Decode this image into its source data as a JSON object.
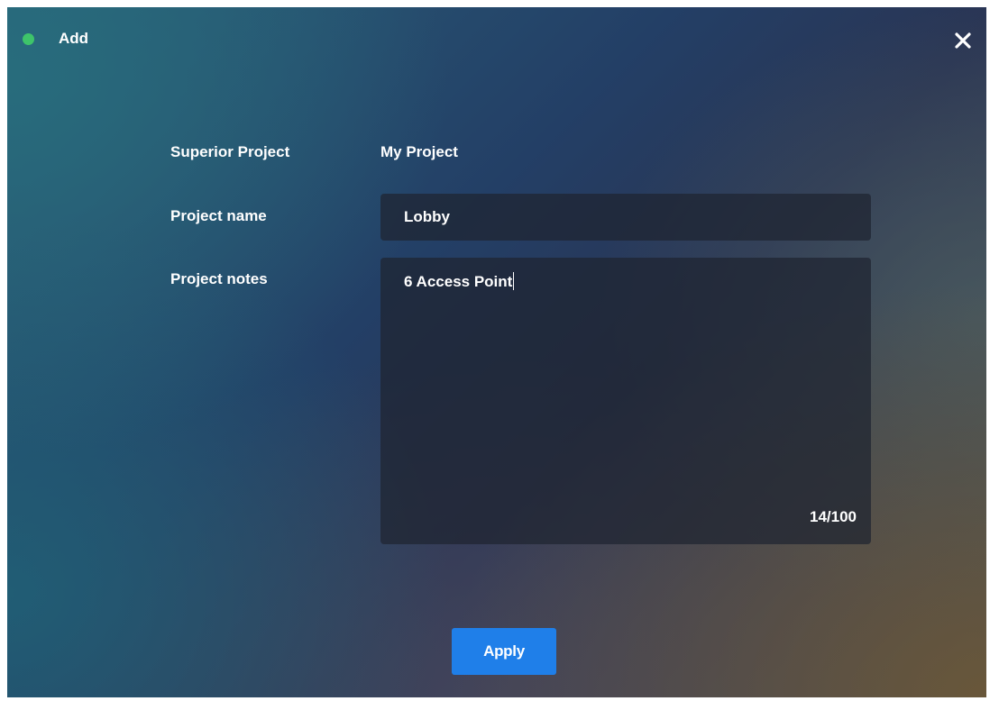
{
  "dialog": {
    "title": "Add",
    "status_color": "#3ec46a",
    "close_icon": "close-icon"
  },
  "form": {
    "superior_project": {
      "label": "Superior Project",
      "value": "My Project"
    },
    "project_name": {
      "label": "Project name",
      "value": "Lobby"
    },
    "project_notes": {
      "label": "Project notes",
      "value": "6 Access Point",
      "char_count": "14/100"
    }
  },
  "actions": {
    "apply_label": "Apply",
    "apply_color": "#1f7fe9"
  }
}
